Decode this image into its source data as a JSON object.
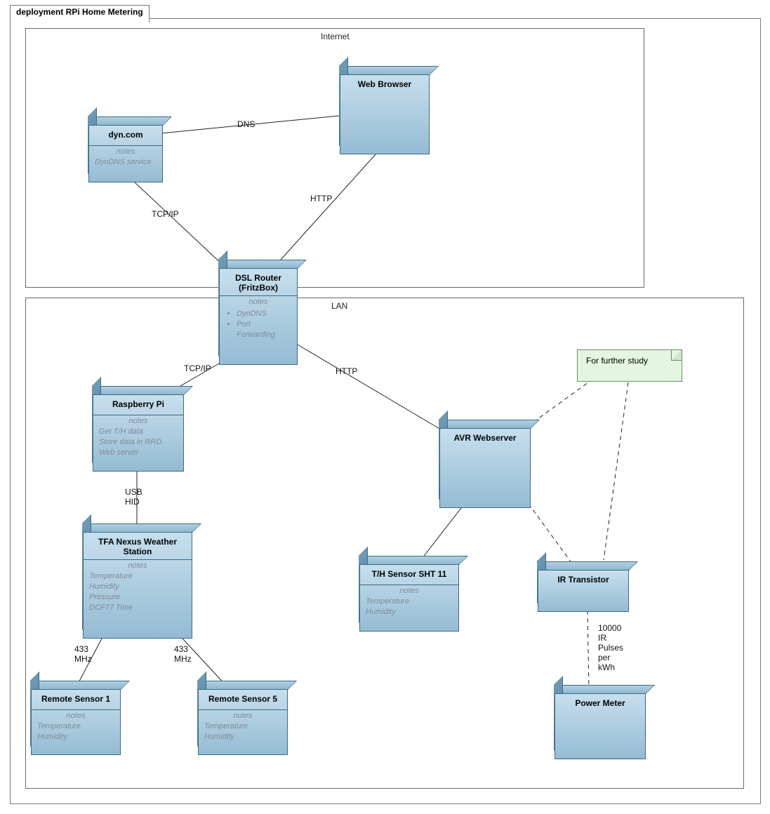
{
  "package": {
    "title": "deployment RPi Home Metering"
  },
  "boundaries": {
    "internet": "Internet",
    "lan": "LAN"
  },
  "nodes": {
    "dyn": {
      "title": "dyn.com",
      "notes_h": "notes",
      "notes": "DynDNS service"
    },
    "browser": {
      "title": "Web Browser"
    },
    "router": {
      "title1": "DSL Router",
      "title2": "(FritzBox)",
      "notes_h": "notes",
      "bullet1": "DynDNS",
      "bullet2": "Port Forwarding"
    },
    "rpi": {
      "title": "Raspberry Pi",
      "notes_h": "notes",
      "l1": "Get T/H data",
      "l2": "Store data in RRD",
      "l3": "Web server"
    },
    "tfa": {
      "title1": "TFA Nexus Weather",
      "title2": "Station",
      "notes_h": "notes",
      "l1": "Temperature",
      "l2": "Humidity",
      "l3": "Pressure",
      "l4": "DCF77 Time"
    },
    "rs1": {
      "title": "Remote Sensor 1",
      "notes_h": "notes",
      "l1": "Temperature",
      "l2": "Humidity"
    },
    "rs5": {
      "title": "Remote Sensor 5",
      "notes_h": "notes",
      "l1": "Temperature",
      "l2": "Humidity"
    },
    "avr": {
      "title": "AVR Webserver"
    },
    "sht": {
      "title": "T/H Sensor SHT 11",
      "notes_h": "notes",
      "l1": "Temperature",
      "l2": "Humidity"
    },
    "irtran": {
      "title": "IR Transistor"
    },
    "pmeter": {
      "title": "Power Meter"
    }
  },
  "links": {
    "dns": "DNS",
    "http1": "HTTP",
    "tcpip1": "TCP/IP",
    "tcpip2": "TCP/IP",
    "http2": "HTTP",
    "usb": "USB\nHID",
    "m1": "433\nMHz",
    "m2": "433\nMHz",
    "irpulses": "10000\nIR\nPulses\nper\nkWh"
  },
  "note": {
    "text": "For further study"
  }
}
